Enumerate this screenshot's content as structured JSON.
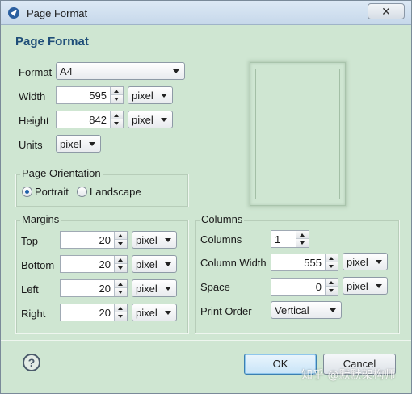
{
  "window": {
    "title": "Page Format",
    "close_glyph": "✕"
  },
  "header": {
    "title": "Page Format"
  },
  "format": {
    "label": "Format",
    "value": "A4"
  },
  "width": {
    "label": "Width",
    "value": "595",
    "unit": "pixel"
  },
  "height": {
    "label": "Height",
    "value": "842",
    "unit": "pixel"
  },
  "units": {
    "label": "Units",
    "value": "pixel"
  },
  "orientation": {
    "title": "Page Orientation",
    "portrait_label": "Portrait",
    "landscape_label": "Landscape",
    "selected": "Portrait"
  },
  "margins": {
    "title": "Margins",
    "rows": [
      {
        "label": "Top",
        "value": "20",
        "unit": "pixel"
      },
      {
        "label": "Bottom",
        "value": "20",
        "unit": "pixel"
      },
      {
        "label": "Left",
        "value": "20",
        "unit": "pixel"
      },
      {
        "label": "Right",
        "value": "20",
        "unit": "pixel"
      }
    ]
  },
  "columns": {
    "title": "Columns",
    "count_label": "Columns",
    "count_value": "1",
    "width_label": "Column Width",
    "width_value": "555",
    "width_unit": "pixel",
    "space_label": "Space",
    "space_value": "0",
    "space_unit": "pixel",
    "order_label": "Print Order",
    "order_value": "Vertical"
  },
  "footer": {
    "help_glyph": "?",
    "ok_label": "OK",
    "cancel_label": "Cancel",
    "watermark": "知乎 @默默架构师"
  },
  "colors": {
    "dialog_bg": "#cfe6d2",
    "header_title": "#1f4e79",
    "radio_dot": "#1d5fa8"
  },
  "icons": [
    "app-icon",
    "close-icon",
    "help-icon",
    "radio-checked",
    "radio-unchecked",
    "chevron-down-icon",
    "spinner-up-icon",
    "spinner-down-icon"
  ]
}
